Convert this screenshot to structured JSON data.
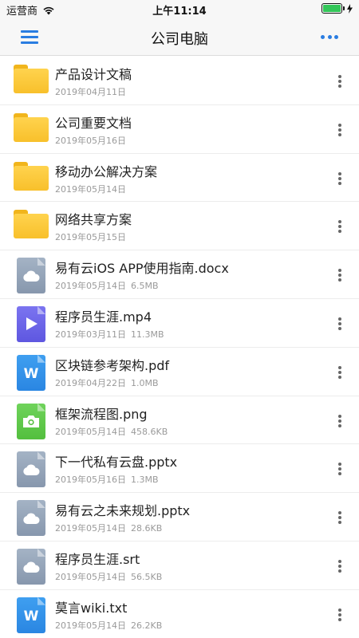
{
  "status": {
    "carrier": "运营商",
    "time": "上午11:14"
  },
  "nav": {
    "title": "公司电脑"
  },
  "files": [
    {
      "name": "产品设计文稿",
      "date": "2019年04月11日",
      "size": "",
      "type": "folder"
    },
    {
      "name": "公司重要文档",
      "date": "2019年05月16日",
      "size": "",
      "type": "folder"
    },
    {
      "name": "移动办公解决方案",
      "date": "2019年05月14日",
      "size": "",
      "type": "folder"
    },
    {
      "name": "网络共享方案",
      "date": "2019年05月15日",
      "size": "",
      "type": "folder"
    },
    {
      "name": "易有云iOS APP使用指南.docx",
      "date": "2019年05月14日",
      "size": "6.5MB",
      "type": "cloud"
    },
    {
      "name": "程序员生涯.mp4",
      "date": "2019年03月11日",
      "size": "11.3MB",
      "type": "video"
    },
    {
      "name": "区块链参考架构.pdf",
      "date": "2019年04月22日",
      "size": "1.0MB",
      "type": "word"
    },
    {
      "name": "框架流程图.png",
      "date": "2019年05月14日",
      "size": "458.6KB",
      "type": "image"
    },
    {
      "name": "下一代私有云盘.pptx",
      "date": "2019年05月16日",
      "size": "1.3MB",
      "type": "cloud"
    },
    {
      "name": "易有云之未来规划.pptx",
      "date": "2019年05月14日",
      "size": "28.6KB",
      "type": "cloud"
    },
    {
      "name": "程序员生涯.srt",
      "date": "2019年05月14日",
      "size": "56.5KB",
      "type": "cloud"
    },
    {
      "name": "莫言wiki.txt",
      "date": "2019年05月14日",
      "size": "26.2KB",
      "type": "word"
    }
  ],
  "icons": {
    "folder": "folder-icon",
    "cloud": "cloud-file-icon",
    "video": "video-file-icon",
    "word": "word-file-icon",
    "image": "image-file-icon"
  },
  "colors": {
    "accent": "#2a7de1",
    "battery": "#33c759",
    "folder": "#f8c02b"
  },
  "battery_level": 1.0
}
